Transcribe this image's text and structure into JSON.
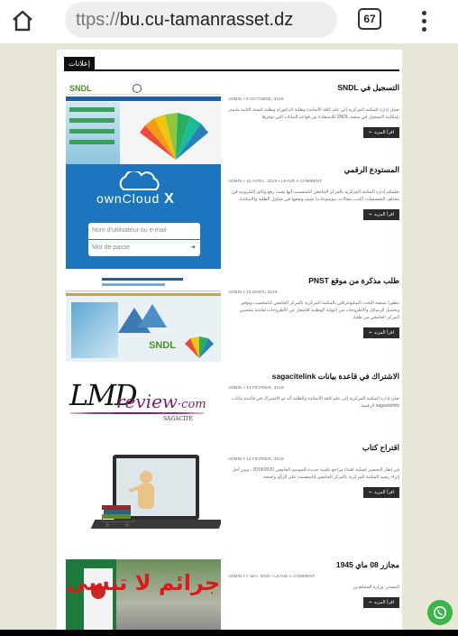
{
  "browser": {
    "url_scheme": "ttps://",
    "url_host": "bu.cu-tamanrasset.dz",
    "tab_count": "67"
  },
  "page": {
    "header_tag": "إعلانات",
    "read_more_label": "اقرأ المزيد ←"
  },
  "posts": [
    {
      "title": "التسجيل في SNDL",
      "meta": "ADMIN  •  5 OCTOBRE, 2019",
      "excerpt": "تعمل إدارة المكتبة المركزية إلى علم كافة الأساتذة وطلبة الدكتوراه وطلبة السنة الثانية ماستر بإمكانية التسجيل في منصة SNDL للاستفادة من قواعد البيانات التي توفرها.",
      "thumb": {
        "logo": "SNDL"
      }
    },
    {
      "title": "المستودع الرقمي",
      "meta": "ADMIN  •  16 AVRIL, 2019  •  LEAVE A COMMENT",
      "excerpt": "تعلمكم إدارة المكتبة المركزية بالمركز الجامعي لتامنغست أنها بصدد رفع وثائق إلكترونية في مختلف التخصصات (كتب، مقالات، موسوعات) سيتم وضعها في متناول الطلبة والأساتذة.",
      "thumb": {
        "logo": "ownCloud",
        "logo_suffix": "X",
        "field_user": "Nom d'utilisateur ou e-mail",
        "field_pass": "Mot de passe"
      }
    },
    {
      "title": "طلب مذكرة من موقع PNST",
      "meta": "ADMIN  •  23 MARS, 2019",
      "excerpt": "تنظيرا بمنصة البحث البيبليوغرافي بالمكتبة المركزية بالمركز الجامعي لتامنغست وتوفير وتحميل الرسائل والأطروحات من البوابة الوطنية للإشعار عن الأطروحات لفائدة منتسبي المركز الجامعي من طلبة.",
      "thumb": {
        "logo": "SNDL"
      }
    },
    {
      "title": "الاشتراك في قاعدة بيانات sagacitelink",
      "meta": "ADMIN  •  13 FÉVRIER, 2019",
      "excerpt": "تعلن إدارة المكتبة المركزية إلى علم كافة الأساتذة والطلبة أنه تم الاشتراك في قاعدة بيانات sagacitelink الرقمية.",
      "thumb": {
        "logo_lmd": "LMD",
        "logo_review": "review",
        "logo_com": "·com",
        "logo_sub": "SAGACITÉ"
      }
    },
    {
      "title": "اقتراح كتاب",
      "meta": "ADMIN  •  12 FÉVRIER, 2019",
      "excerpt": "في إطار التحضير لعملية اقتناء مراجع علمية جديدة للموسم الجامعي 2019/2020 ، ومن أجل إثراء رصيد المكتبة المركزية بالمركز الجامعي لتامنغست على الرأي واضحة.",
      "thumb": {}
    },
    {
      "title": "مجازر 08 ماي 1945",
      "meta": "ADMIN  •  7 MAI, 2020  •  LEAVE A COMMENT",
      "excerpt": "المصدر: وزارة المجاهدين",
      "thumb": {
        "caption": "جرائم لا تنسى"
      }
    }
  ],
  "colors": {
    "page_bg": "#e8e6d6",
    "whatsapp": "#3ab54a",
    "owncloud_blue": "#1d76bd"
  }
}
